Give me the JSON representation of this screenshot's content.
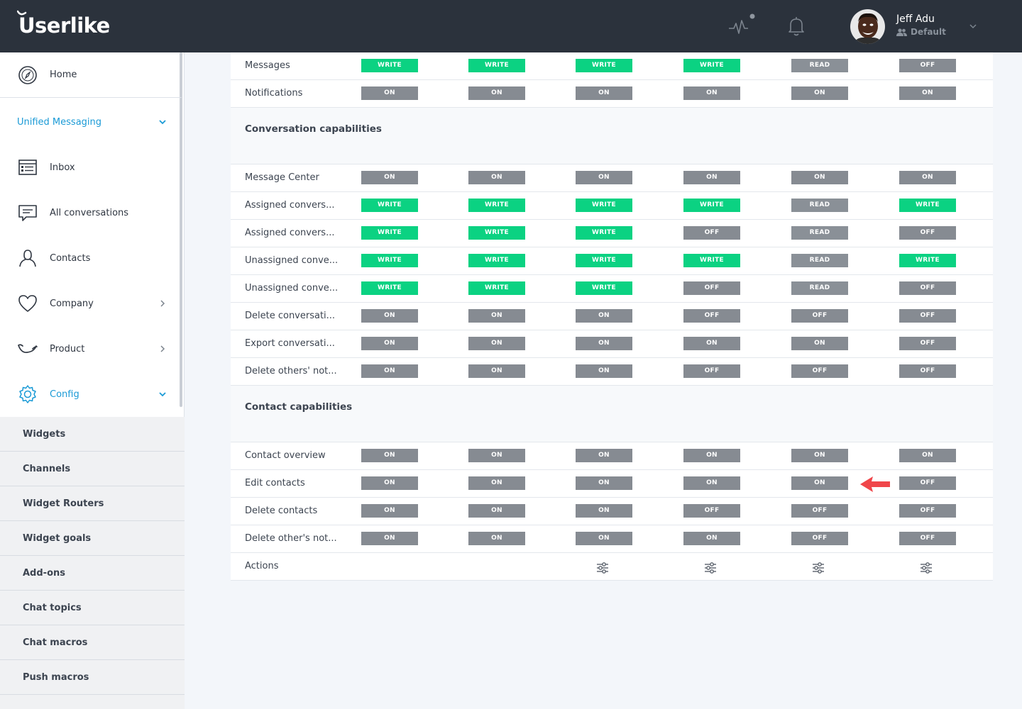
{
  "app": {
    "logo": "Userlike"
  },
  "user": {
    "name": "Jeff Adu",
    "role": "Default"
  },
  "sidebar": {
    "home": "Home",
    "unified_messaging": "Unified Messaging",
    "items": [
      {
        "label": "Inbox",
        "icon": "inbox-icon"
      },
      {
        "label": "All conversations",
        "icon": "chat-icon"
      },
      {
        "label": "Contacts",
        "icon": "contact-icon"
      },
      {
        "label": "Company",
        "icon": "heart-icon"
      },
      {
        "label": "Product",
        "icon": "product-icon"
      },
      {
        "label": "Config",
        "icon": "gear-icon"
      }
    ],
    "config_items": [
      "Widgets",
      "Channels",
      "Widget Routers",
      "Widget goals",
      "Add-ons",
      "Chat topics",
      "Chat macros",
      "Push macros"
    ]
  },
  "table": {
    "rows_top": [
      {
        "label": "Messages",
        "values": [
          "WRITE",
          "WRITE",
          "WRITE",
          "WRITE",
          "READ",
          "OFF"
        ]
      },
      {
        "label": "Notifications",
        "values": [
          "ON",
          "ON",
          "ON",
          "ON",
          "ON",
          "ON"
        ]
      }
    ],
    "conversation_title": "Conversation capabilities",
    "conversation_rows": [
      {
        "label": "Message Center",
        "values": [
          "ON",
          "ON",
          "ON",
          "ON",
          "ON",
          "ON"
        ]
      },
      {
        "label": "Assigned convers...",
        "values": [
          "WRITE",
          "WRITE",
          "WRITE",
          "WRITE",
          "READ",
          "WRITE"
        ]
      },
      {
        "label": "Assigned convers...",
        "values": [
          "WRITE",
          "WRITE",
          "WRITE",
          "OFF",
          "READ",
          "OFF"
        ]
      },
      {
        "label": "Unassigned conve...",
        "values": [
          "WRITE",
          "WRITE",
          "WRITE",
          "WRITE",
          "READ",
          "WRITE"
        ]
      },
      {
        "label": "Unassigned conve...",
        "values": [
          "WRITE",
          "WRITE",
          "WRITE",
          "OFF",
          "READ",
          "OFF"
        ]
      },
      {
        "label": "Delete conversati...",
        "values": [
          "ON",
          "ON",
          "ON",
          "OFF",
          "OFF",
          "OFF"
        ]
      },
      {
        "label": "Export conversati...",
        "values": [
          "ON",
          "ON",
          "ON",
          "ON",
          "ON",
          "OFF"
        ]
      },
      {
        "label": "Delete others' not...",
        "values": [
          "ON",
          "ON",
          "ON",
          "OFF",
          "OFF",
          "OFF"
        ]
      }
    ],
    "contact_title": "Contact capabilities",
    "contact_rows": [
      {
        "label": "Contact overview",
        "values": [
          "ON",
          "ON",
          "ON",
          "ON",
          "ON",
          "ON"
        ]
      },
      {
        "label": "Edit contacts",
        "values": [
          "ON",
          "ON",
          "ON",
          "ON",
          "ON",
          "OFF"
        ]
      },
      {
        "label": "Delete contacts",
        "values": [
          "ON",
          "ON",
          "ON",
          "OFF",
          "OFF",
          "OFF"
        ]
      },
      {
        "label": "Delete other's not...",
        "values": [
          "ON",
          "ON",
          "ON",
          "ON",
          "OFF",
          "OFF"
        ]
      }
    ],
    "actions_label": "Actions"
  },
  "colors": {
    "topbar": "#2b323c",
    "accent": "#1a9ad6",
    "write": "#0bd282",
    "neutral_badge": "#868b92",
    "arrow": "#f0464a"
  }
}
